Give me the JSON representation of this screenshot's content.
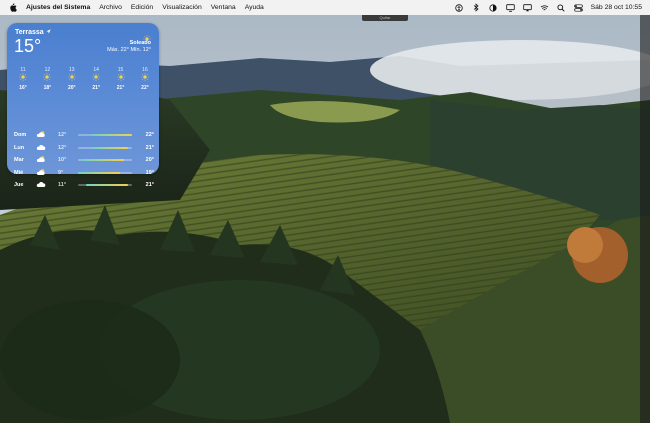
{
  "menubar": {
    "app_name": "Ajustes del Sistema",
    "menus": [
      "Archivo",
      "Edición",
      "Visualización",
      "Ventana",
      "Ayuda"
    ],
    "datetime": "Sáb 28 oct  10:55",
    "status_icons": [
      "accessibility-icon",
      "bluetooth-icon",
      "contrast-icon",
      "screen-mirroring-icon",
      "cast-icon",
      "wifi-icon",
      "search-icon",
      "control-center-icon"
    ]
  },
  "widget": {
    "location": "Terrassa",
    "current_temp": "15°",
    "condition": "Soleado",
    "hilo": "Máx. 22° Mín. 12°",
    "hourly": [
      {
        "hour": "11",
        "icon": "sun-icon",
        "temp": "16°"
      },
      {
        "hour": "12",
        "icon": "sun-icon",
        "temp": "18°"
      },
      {
        "hour": "13",
        "icon": "sun-icon",
        "temp": "20°"
      },
      {
        "hour": "14",
        "icon": "sun-icon",
        "temp": "21°"
      },
      {
        "hour": "15",
        "icon": "sun-icon",
        "temp": "21°"
      },
      {
        "hour": "16",
        "icon": "sun-icon",
        "temp": "22°"
      }
    ],
    "daily": [
      {
        "day": "Dom",
        "icon": "partly-cloudy-icon",
        "low": "12°",
        "high": "22°",
        "range_start": 0.25,
        "range_end": 1.0
      },
      {
        "day": "Lun",
        "icon": "cloud-icon",
        "low": "12°",
        "high": "21°",
        "range_start": 0.25,
        "range_end": 0.92
      },
      {
        "day": "Mar",
        "icon": "partly-cloudy-icon",
        "low": "10°",
        "high": "20°",
        "range_start": 0.08,
        "range_end": 0.85
      },
      {
        "day": "Mié",
        "icon": "partly-cloudy-icon",
        "low": "9°",
        "high": "19°",
        "range_start": 0.0,
        "range_end": 0.77
      },
      {
        "day": "Jue",
        "icon": "cloud-icon",
        "low": "11°",
        "high": "21°",
        "range_start": 0.15,
        "range_end": 0.92
      }
    ]
  },
  "badge": "Quitar"
}
